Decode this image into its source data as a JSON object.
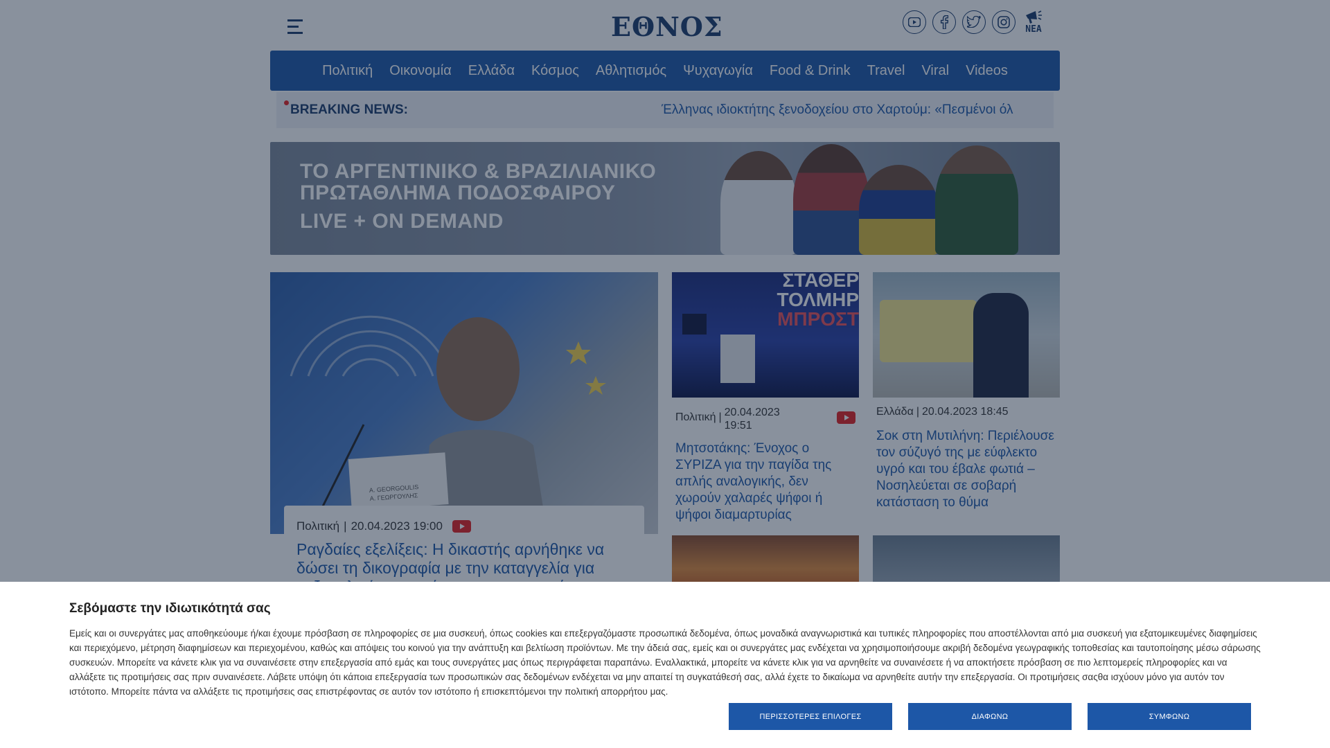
{
  "site": {
    "logo": "ΕΘΝΟΣ",
    "nea_label": "ΝΕΑ"
  },
  "colors": {
    "brand_blue": "#1d57a7",
    "navy": "#1b3b6b",
    "live_red": "#e52121"
  },
  "social_icons": [
    "youtube-icon",
    "facebook-icon",
    "twitter-icon",
    "instagram-icon"
  ],
  "nav": {
    "items": [
      "Πολιτική",
      "Οικονομία",
      "Ελλάδα",
      "Κόσμος",
      "Αθλητισμός",
      "Ψυχαγωγία",
      "Food & Drink",
      "Travel",
      "Viral",
      "Videos"
    ]
  },
  "breaking": {
    "label": "BREAKING NEWS:",
    "text": "Έλληνας ιδιοκτήτης ξενοδοχείου στο Χαρτούμ: «Πεσμένοι όλ"
  },
  "banner": {
    "line1": "ΤΟ ΑΡΓΕΝΤΙΝΙΚΟ & ΒΡΑΖΙΛΙΑΝΙΚΟ",
    "line2": "ΠΡΩΤΑΘΛΗΜΑ ΠΟΔΟΣΦΑΙΡΟΥ",
    "line3": "LIVE + ON DEMAND"
  },
  "articles": {
    "hero": {
      "category": "Πολιτική",
      "date": "20.04.2023 19:00",
      "title": "Ραγδαίες εξελίξεις: Η δικαστής αρνήθηκε να δώσει τη δικογραφία με την καταγγελία για σεξουαλική κακοποίηση στους συνηγόρους",
      "nameplate": "Α. GEORGOULIS\nΑ. ΓΕΩΡΓΟΥΛΗΣ"
    },
    "card1": {
      "category": "Πολιτική",
      "date": "20.04.2023",
      "time": "19:51",
      "title": "Μητσοτάκης: Ένοχος ο ΣΥΡΙΖΑ για την παγίδα της απλής αναλογικής, δεν χωρούν χαλαρές ψήφοι ή ψήφοι διαμαρτυρίας",
      "img_text1": "ΣΤΑΘΕΡ",
      "img_text2": "ΤΟΛΜΗΡ",
      "img_text3": "ΜΠΡΟΣΤ"
    },
    "card2": {
      "category": "Ελλάδα",
      "date": "20.04.2023 18:45",
      "title": "Σοκ στη Μυτιλήνη: Περιέλουσε τον σύζυγό της με εύφλεκτο υγρό και του έβαλε φωτιά – Νοσηλεύεται σε σοβαρή κατάσταση το θύμα"
    }
  },
  "consent": {
    "title": "Σεβόμαστε την ιδιωτικότητά σας",
    "text": "Εμείς και οι συνεργάτες μας αποθηκεύουμε ή/και έχουμε πρόσβαση σε πληροφορίες σε μια συσκευή, όπως cookies και επεξεργαζόμαστε προσωπικά δεδομένα, όπως μοναδικά αναγνωριστικά και τυπικές πληροφορίες που αποστέλλονται από μια συσκευή για εξατομικευμένες διαφημίσεις και περιεχόμενο, μέτρηση διαφημίσεων και περιεχομένου, καθώς και απόψεις του κοινού για την ανάπτυξη και βελτίωση προϊόντων. Με την άδειά σας, εμείς και οι συνεργάτες μας ενδέχεται να χρησιμοποιήσουμε ακριβή δεδομένα γεωγραφικής τοποθεσίας και ταυτοποίησης μέσω σάρωσης συσκευών. Μπορείτε να κάνετε κλικ για να συναινέσετε στην επεξεργασία από εμάς και τους συνεργάτες μας όπως περιγράφεται παραπάνω. Εναλλακτικά, μπορείτε να κάνετε κλικ για να αρνηθείτε να συναινέσετε ή να αποκτήσετε πρόσβαση σε πιο λεπτομερείς πληροφορίες και να αλλάξετε τις προτιμήσεις σας πριν συναινέσετε. Λάβετε υπόψη ότι κάποια επεξεργασία των προσωπικών σας δεδομένων ενδέχεται να μην απαιτεί τη συγκατάθεσή σας, αλλά έχετε το δικαίωμα να αρνηθείτε αυτήν την επεξεργασία. Οι προτιμήσεις σαςθα ισχύουν μόνο για αυτόν τον ιστότοπο. Μπορείτε πάντα να αλλάξετε τις προτιμήσεις σας επιστρέφοντας σε αυτόν τον ιστότοπο ή επισκεπτόμενοι την πολιτική απορρήτου μας.",
    "btn_more": "ΠΕΡΙΣΣΟΤΕΡΕΣ ΕΠΙΛΟΓΕΣ",
    "btn_disagree": "ΔΙΑΦΩΝΩ",
    "btn_agree": "ΣΥΜΦΩΝΩ"
  }
}
